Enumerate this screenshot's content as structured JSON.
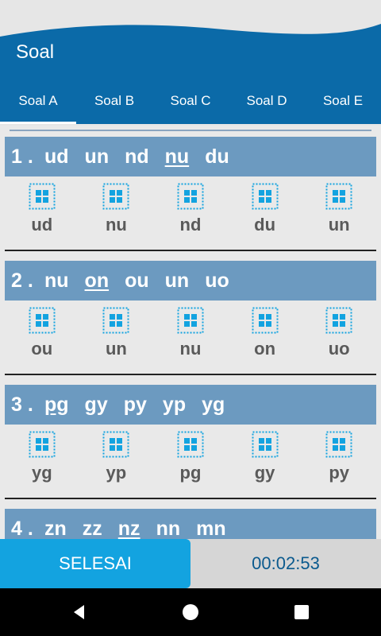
{
  "app": {
    "title": "Soal"
  },
  "tabs": [
    {
      "label": "Soal A",
      "active": true
    },
    {
      "label": "Soal B",
      "active": false
    },
    {
      "label": "Soal C",
      "active": false
    },
    {
      "label": "Soal D",
      "active": false
    },
    {
      "label": "Soal E",
      "active": false
    }
  ],
  "questions": [
    {
      "number": "1 .",
      "choices": [
        "ud",
        "un",
        "nd",
        "nu",
        "du"
      ],
      "underlined": 3,
      "answers": [
        "ud",
        "nu",
        "nd",
        "du",
        "un"
      ]
    },
    {
      "number": "2 .",
      "choices": [
        "nu",
        "on",
        "ou",
        "un",
        "uo"
      ],
      "underlined": 1,
      "answers": [
        "ou",
        "un",
        "nu",
        "on",
        "uo"
      ]
    },
    {
      "number": "3 .",
      "choices": [
        "pg",
        "gy",
        "py",
        "yp",
        "yg"
      ],
      "underlined": 0,
      "answers": [
        "yg",
        "yp",
        "pg",
        "gy",
        "py"
      ]
    },
    {
      "number": "4 .",
      "choices": [
        "zn",
        "zz",
        "nz",
        "nn",
        "mn"
      ],
      "underlined": 2,
      "answers": []
    }
  ],
  "bottom": {
    "finish_label": "SELESAI",
    "timer": "00:02:53"
  },
  "colors": {
    "accent": "#13a3e0",
    "tab_bar": "#0b6aa8",
    "question_bar": "#6c9ac0"
  }
}
